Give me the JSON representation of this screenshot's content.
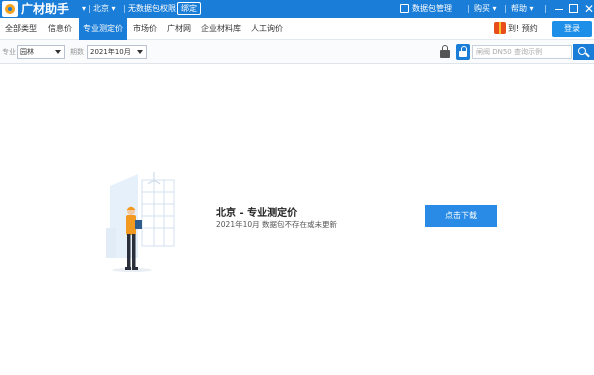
{
  "titlebar": {
    "app_name": "广材助手",
    "dot1": "▾",
    "city": "北京",
    "city_caret": "▾",
    "permission": "无数据包权限",
    "bind": "绑定",
    "data_pkg": "数据包管理",
    "buy": "购买",
    "buy_caret": "▾",
    "help": "帮助",
    "help_caret": "▾",
    "close": "✕"
  },
  "nav": {
    "tabs": [
      {
        "label": "全部类型"
      },
      {
        "label": "信息价"
      },
      {
        "label": "专业测定价",
        "active": true
      },
      {
        "label": "市场价"
      },
      {
        "label": "广材网"
      },
      {
        "label": "企业材料库"
      },
      {
        "label": "人工询价"
      }
    ],
    "promo": "到! 预约",
    "login": "登录"
  },
  "filters": {
    "specialty_label": "专业",
    "specialty_value": "园林",
    "period_label": "期数",
    "period_value": "2021年10月",
    "search_placeholder": "闸阀 DN50 查询示例"
  },
  "empty_state": {
    "title": "北京 - 专业测定价",
    "subtitle": "2021年10月 数据包不存在或未更新",
    "download": "点击下载"
  },
  "colors": {
    "brand_blue": "#1a7dd7",
    "button_blue": "#2a8be6"
  }
}
